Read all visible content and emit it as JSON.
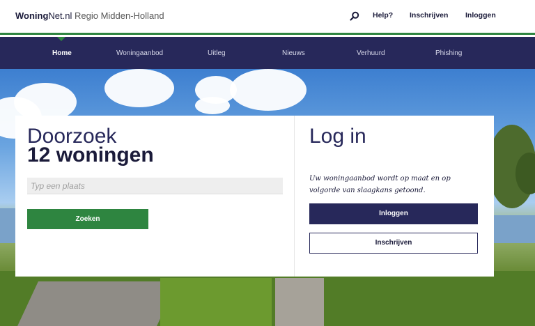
{
  "header": {
    "brand_bold": "Woning",
    "brand_rest": "Net.nl",
    "region": "Regio Midden-Holland",
    "search_icon": "search-icon",
    "links": {
      "help": "Help?",
      "register": "Inschrijven",
      "login": "Inloggen"
    }
  },
  "nav": {
    "items": [
      "Home",
      "Woningaanbod",
      "Uitleg",
      "Nieuws",
      "Verhuurd",
      "Phishing"
    ],
    "active": "Home"
  },
  "search": {
    "title_line1": "Doorzoek",
    "title_line2": "12 woningen",
    "placeholder": "Typ een plaats",
    "button": "Zoeken"
  },
  "login": {
    "title": "Log in",
    "text": "Uw woningaanbod wordt op maat en op volgorde van slaagkans getoond.",
    "login_button": "Inloggen",
    "register_button": "Inschrijven"
  },
  "colors": {
    "primary": "#27285a",
    "accent": "#2e8540"
  }
}
